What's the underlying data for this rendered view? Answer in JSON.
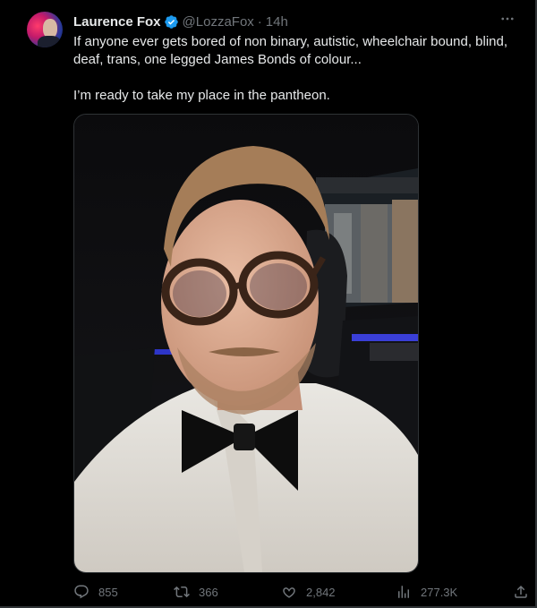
{
  "author": {
    "name": "Laurence Fox",
    "handle": "@LozzaFox",
    "separator": "·",
    "time": "14h"
  },
  "tweet": {
    "paragraphs": [
      "If anyone ever gets bored of non binary, autistic, wheelchair bound, blind, deaf, trans, one legged James Bonds of colour...",
      "I’m ready to take my place in the pantheon."
    ]
  },
  "actions": {
    "replies": "855",
    "retweets": "366",
    "likes": "2,842",
    "views": "277.3K"
  },
  "icons": {
    "verified": "verified-badge-icon",
    "more": "more-icon",
    "reply": "reply-icon",
    "retweet": "retweet-icon",
    "like": "heart-icon",
    "views": "views-chart-icon",
    "share": "share-icon"
  },
  "colors": {
    "background": "#000000",
    "text": "#e7e9ea",
    "muted": "#71767b",
    "verified": "#1d9bf0",
    "border": "#2f3336"
  }
}
